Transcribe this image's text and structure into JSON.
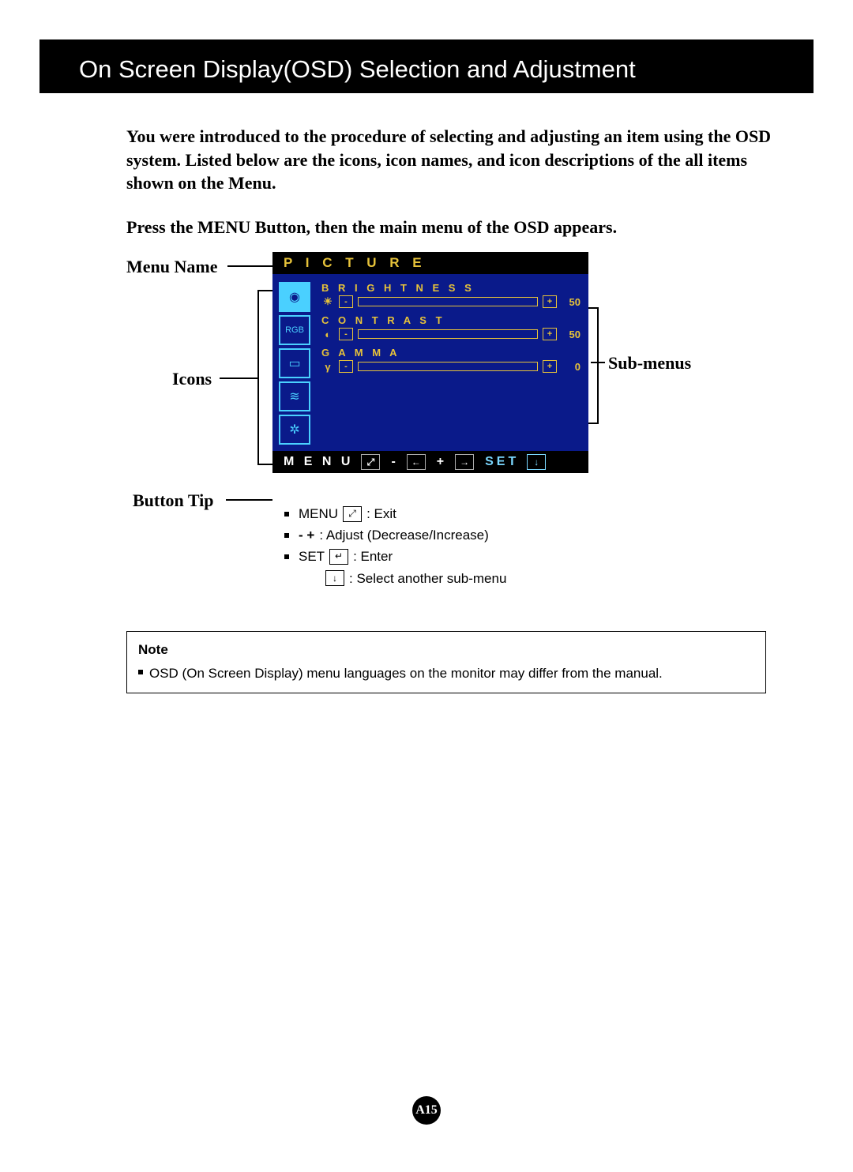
{
  "header": {
    "title": "On Screen Display(OSD) Selection and Adjustment"
  },
  "intro": {
    "p1": "You were introduced to the procedure of selecting and adjusting an item using the OSD system.  Listed below are the icons, icon names, and icon descriptions of the all items shown on the Menu.",
    "p2": "Press the MENU Button, then the main menu of the OSD appears."
  },
  "labels": {
    "menu_name": "Menu Name",
    "icons": "Icons",
    "button_tip": "Button Tip",
    "sub_menus": "Sub-menus"
  },
  "osd": {
    "title": "P I C T U R E",
    "icons": [
      "picture",
      "rgb",
      "screen",
      "wave",
      "gear"
    ],
    "settings": [
      {
        "label": "B R I G H T N E S S",
        "symbol": "☀",
        "value": 50,
        "percent": 50
      },
      {
        "label": "C O N T R A S T",
        "symbol": "◐",
        "value": 50,
        "percent": 50
      },
      {
        "label": "G A M M A",
        "symbol": "γ",
        "value": 0,
        "percent": 0
      }
    ],
    "tipbar": {
      "menu": "M E N U",
      "minus": "-",
      "plus": "+",
      "set": "SET"
    }
  },
  "tips": [
    {
      "prefix": "MENU",
      "icon": "⤢",
      "text": ": Exit"
    },
    {
      "prefix": "-    +",
      "icon": "",
      "text": ": Adjust (Decrease/Increase)"
    },
    {
      "prefix": "SET",
      "icon": "↵",
      "text": ": Enter"
    },
    {
      "prefix": "",
      "icon": "↓",
      "text": ": Select another sub-menu"
    }
  ],
  "note": {
    "heading": "Note",
    "text": "OSD (On Screen Display) menu languages on the monitor may differ from the manual."
  },
  "page_number": "A15"
}
